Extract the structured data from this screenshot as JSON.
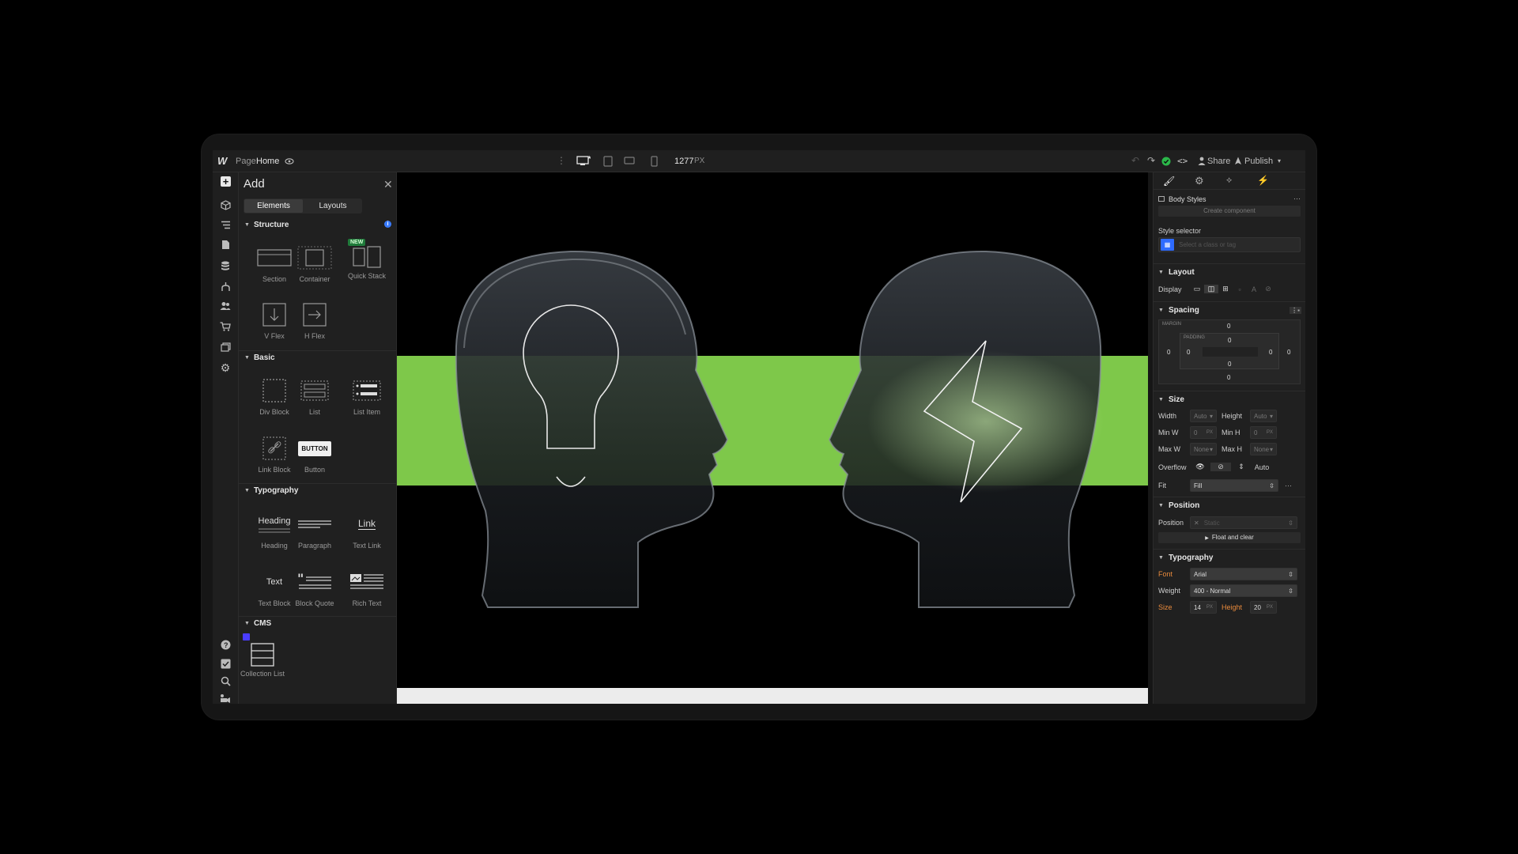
{
  "topbar": {
    "logo": "W",
    "page_label": "Page:",
    "page_name": "Home",
    "width_value": "1277",
    "width_unit": "PX",
    "share_label": "Share",
    "publish_label": "Publish"
  },
  "add_panel": {
    "title": "Add",
    "tabs": [
      {
        "label": "Elements"
      },
      {
        "label": "Layouts"
      }
    ],
    "sections": {
      "structure": "Structure",
      "basic": "Basic",
      "typography": "Typography",
      "cms": "CMS"
    },
    "new_badge": "NEW",
    "items": {
      "section": "Section",
      "container": "Container",
      "quick_stack": "Quick Stack",
      "v_flex": "V Flex",
      "h_flex": "H Flex",
      "div_block": "Div Block",
      "list": "List",
      "list_item": "List Item",
      "link_block": "Link Block",
      "button": "Button",
      "button_preview": "BUTTON",
      "heading": "Heading",
      "heading_preview": "Heading",
      "paragraph": "Paragraph",
      "text_link": "Text Link",
      "link_preview": "Link",
      "text_block": "Text Block",
      "text_preview": "Text",
      "block_quote": "Block Quote",
      "rich_text": "Rich Text",
      "collection_list": "Collection List"
    }
  },
  "style_panel": {
    "body_styles": "Body Styles",
    "create_component": "Create component",
    "style_selector_label": "Style selector",
    "style_selector_placeholder": "Select a class or tag",
    "layout": {
      "title": "Layout",
      "display_label": "Display"
    },
    "spacing": {
      "title": "Spacing",
      "margin_label": "MARGIN",
      "padding_label": "PADDING",
      "margin_top": "0",
      "margin_right": "0",
      "margin_bottom": "0",
      "margin_left": "0",
      "padding_top": "0",
      "padding_right": "0",
      "padding_bottom": "0",
      "padding_left": "0"
    },
    "size": {
      "title": "Size",
      "width_label": "Width",
      "width_value": "Auto",
      "height_label": "Height",
      "height_value": "Auto",
      "min_w_label": "Min W",
      "min_w_value": "0",
      "min_w_unit": "PX",
      "min_h_label": "Min H",
      "min_h_value": "0",
      "min_h_unit": "PX",
      "max_w_label": "Max W",
      "max_w_value": "None",
      "max_h_label": "Max H",
      "max_h_value": "None",
      "overflow_label": "Overflow",
      "overflow_auto": "Auto",
      "fit_label": "Fit",
      "fit_value": "Fill"
    },
    "position": {
      "title": "Position",
      "position_label": "Position",
      "position_value": "Static",
      "float_clear": "Float and clear"
    },
    "typography": {
      "title": "Typography",
      "font_label": "Font",
      "font_value": "Arial",
      "weight_label": "Weight",
      "weight_value": "400 - Normal",
      "size_label": "Size",
      "size_value": "14",
      "size_unit": "PX",
      "height_label": "Height",
      "height_value": "20",
      "height_unit": "PX"
    }
  },
  "colors": {
    "accent_green": "#7ec84a",
    "accent_blue": "#2e6bff",
    "highlight_orange": "#e98a3c",
    "badge_green": "#1f7a3a"
  }
}
